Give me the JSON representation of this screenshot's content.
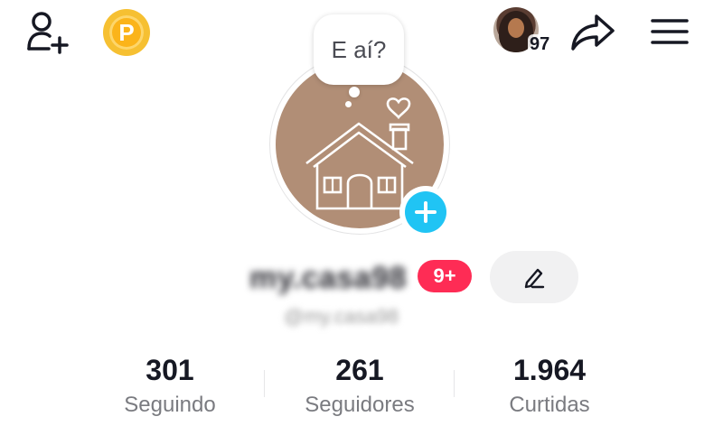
{
  "topbar": {
    "add_friend_icon": "person-plus-icon",
    "coin_letter": "P",
    "coin_color": "#f6c032",
    "visitor_count": "97",
    "share_icon": "share-arrow-icon",
    "menu_icon": "hamburger-menu-icon"
  },
  "profile": {
    "bubble_text": "E aí?",
    "picture_bg": "#b18e76",
    "add_photo_color": "#20c4f4",
    "username": "my.casa98",
    "handle": "@my.casa98",
    "badge": "9+",
    "badge_color": "#fe2c55"
  },
  "stats": [
    {
      "value": "301",
      "label": "Seguindo"
    },
    {
      "value": "261",
      "label": "Seguidores"
    },
    {
      "value": "1.964",
      "label": "Curtidas"
    }
  ]
}
